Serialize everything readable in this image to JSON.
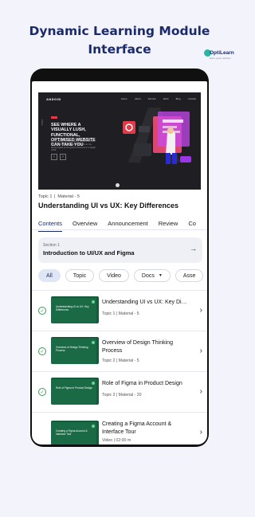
{
  "header": {
    "title_line1": "Dynamic Learning Module",
    "title_line2": "Interface",
    "brand_name": "OptiLearn",
    "brand_tagline": "learn, grow, achieve"
  },
  "video": {
    "logo": "ANDOID",
    "menu": [
      "Home",
      "About",
      "Service",
      "Work",
      "Blog",
      "Contact"
    ],
    "side_text": "Follow",
    "headline": "SEE WHERE A VISUALLY LUSH, FUNCTIONAL, OPTIMISED WEBSITE CAN TAKE YOU",
    "body": "We are driven by the pursuit of website success. We Build bold brands that work. Here at, the driving digital as the good of business in a digital world.",
    "big_glyph": "Ʌ"
  },
  "course": {
    "topic": "Topic 1",
    "material": "Material - 5",
    "title": "Understanding UI vs UX: Key Differences"
  },
  "tabs": [
    "Contents",
    "Overview",
    "Announcement",
    "Review",
    "Co"
  ],
  "section": {
    "label": "Section 1",
    "title": "Introduction to UI/UX and Figma"
  },
  "filters": [
    "All",
    "Topic",
    "Video",
    "Docs",
    "Asse"
  ],
  "lessons": [
    {
      "title": "Understanding UI vs UX: Key Differe...",
      "thumb_text": "Understanding UI vs UX: Key Differences",
      "sub": "Topic 1 | Material - 5"
    },
    {
      "title": "Overview of Design Thinking Process",
      "thumb_text": "Overview of Design Thinking Process",
      "sub": "Topic 2 | Material - 5"
    },
    {
      "title": "Role of Figma in Product Design",
      "thumb_text": "Role of Figma in Product Design",
      "sub": "Topic 3 | Material - 20"
    },
    {
      "title": "Creating a Figma Account & Interface Tour",
      "thumb_text": "Creating a Figma Account & Interface Tour",
      "sub": "Video | 02:00 m"
    }
  ],
  "colors": {
    "navy": "#1b2a6b",
    "check_green": "#3f9a56",
    "thumb_green": "#155b3b",
    "active_chip_bg": "#dfe7f7"
  }
}
